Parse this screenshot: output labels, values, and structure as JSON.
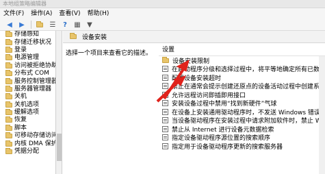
{
  "window": {
    "title": "本地组策略编辑器"
  },
  "menu": [
    "文件(F)",
    "操作(A)",
    "查看(V)",
    "帮助(H)"
  ],
  "toolbar": [
    "back-icon",
    "forward-icon",
    "folder-icon",
    "list-icon",
    "help-icon",
    "properties-icon",
    "filter-icon"
  ],
  "tree": [
    "存储感知",
    "存储迁移状况",
    "登录",
    "电源管理",
    "访问被拒绝协助",
    "分布式 COM",
    "服务控制管理器",
    "服务器管理器",
    "关机",
    "关机选项",
    "缓解选项",
    "恢复",
    "脚本",
    "可移动存储访问",
    "内核 DMA 保护",
    "凭据分配"
  ],
  "panel": {
    "header": "设备安装",
    "description": "选择一个项目来查看它的描述。"
  },
  "list": {
    "column": "设置",
    "rows": [
      {
        "label": "设备安装限制",
        "icon": "folder"
      },
      {
        "label": "在启动程序分级和选择过程中，将平等地确定所有已数字签...",
        "icon": "setting"
      },
      {
        "label": "配置设备安装超时",
        "icon": "setting"
      },
      {
        "label": "禁止在通常会提示创建还原点的设备活动过程中创建系统还...",
        "icon": "setting"
      },
      {
        "label": "允许远程访问即插即用接口",
        "icon": "setting"
      },
      {
        "label": "安装设备过程中禁用“找到新硬件”气球",
        "icon": "setting"
      },
      {
        "label": "在设备上安装通用驱动程序时，不发送 Windows 错误报告",
        "icon": "setting"
      },
      {
        "label": "当设备驱动程序在安装过程中请求附加软件时，禁止 Wind...",
        "icon": "setting"
      },
      {
        "label": "禁止从 Internet 进行设备元数据检索",
        "icon": "setting"
      },
      {
        "label": "指定设备驱动程序源位置的搜索顺序",
        "icon": "setting"
      },
      {
        "label": "指定用于设备驱动程序更新的搜索服务器",
        "icon": "setting"
      }
    ]
  },
  "colors": {
    "annotation": "#e0231c",
    "folder": "#e8c46a"
  }
}
